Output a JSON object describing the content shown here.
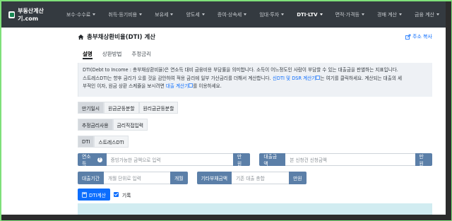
{
  "nav": {
    "brand": "부동산계산기.com",
    "items": [
      {
        "label": "보수·수수료",
        "active": false
      },
      {
        "label": "취득·등기비용",
        "active": false
      },
      {
        "label": "보유세",
        "active": false
      },
      {
        "label": "양도세",
        "active": false
      },
      {
        "label": "증여·상속세",
        "active": false
      },
      {
        "label": "임대·투자",
        "active": false
      },
      {
        "label": "DTI·LTV",
        "active": true
      },
      {
        "label": "면적·가격등",
        "active": false
      },
      {
        "label": "경매 계산",
        "active": false
      },
      {
        "label": "금융 계산",
        "active": false
      }
    ]
  },
  "page": {
    "title": "총부채상환비율(DTI) 계산",
    "copy_link": "주소 복사"
  },
  "info_tabs": [
    "설명",
    "상환방법",
    "추정금리"
  ],
  "info": {
    "line1": "DTI(Debt to Income : 총부채상환비율)은 연소득 대비 금융비용 부담률을 의미합니다. 소득이 어느정도인 사람이 부담할 수 있는 대출금을 판별하는 지표입니다.",
    "line2a": "스트레스DTI는 향후 금리가 오를 것을 감안하여 적용 금리에 일부 가산금리를 더해서 계산합니다.",
    "line2_link": "신DTI 및 DSR 계산기",
    "line2b": "는 여기를 클릭하세요. 계산되는 대출의 세",
    "line3a": "부적인 이자, 원금 상환 스케쥴을 보시려면",
    "line3_link": "대출 계산기",
    "line3b": "를 이용하세요."
  },
  "repay_methods": [
    "만기일시",
    "원금균등분할",
    "원리금균등분할"
  ],
  "rate_modes": [
    "추정금리사용",
    "금리직접입력"
  ],
  "dti_modes": [
    "DTI",
    "스트레스DTI"
  ],
  "fields": {
    "income_label": "연소득",
    "income_placeholder": "증빙가능한 금액으로 입력",
    "income_unit": "만원",
    "loan_label": "대출금액",
    "loan_placeholder": "본 신청건 신청금액",
    "loan_unit": "만원",
    "term_label": "대출기간",
    "term_placeholder": "개월 단위로 입력",
    "term_unit": "개월",
    "other_label": "기타부채금액",
    "other_placeholder": "기존 대출 총합",
    "other_unit": "만원"
  },
  "calc_button": "DTI계산",
  "save_label": "기록"
}
